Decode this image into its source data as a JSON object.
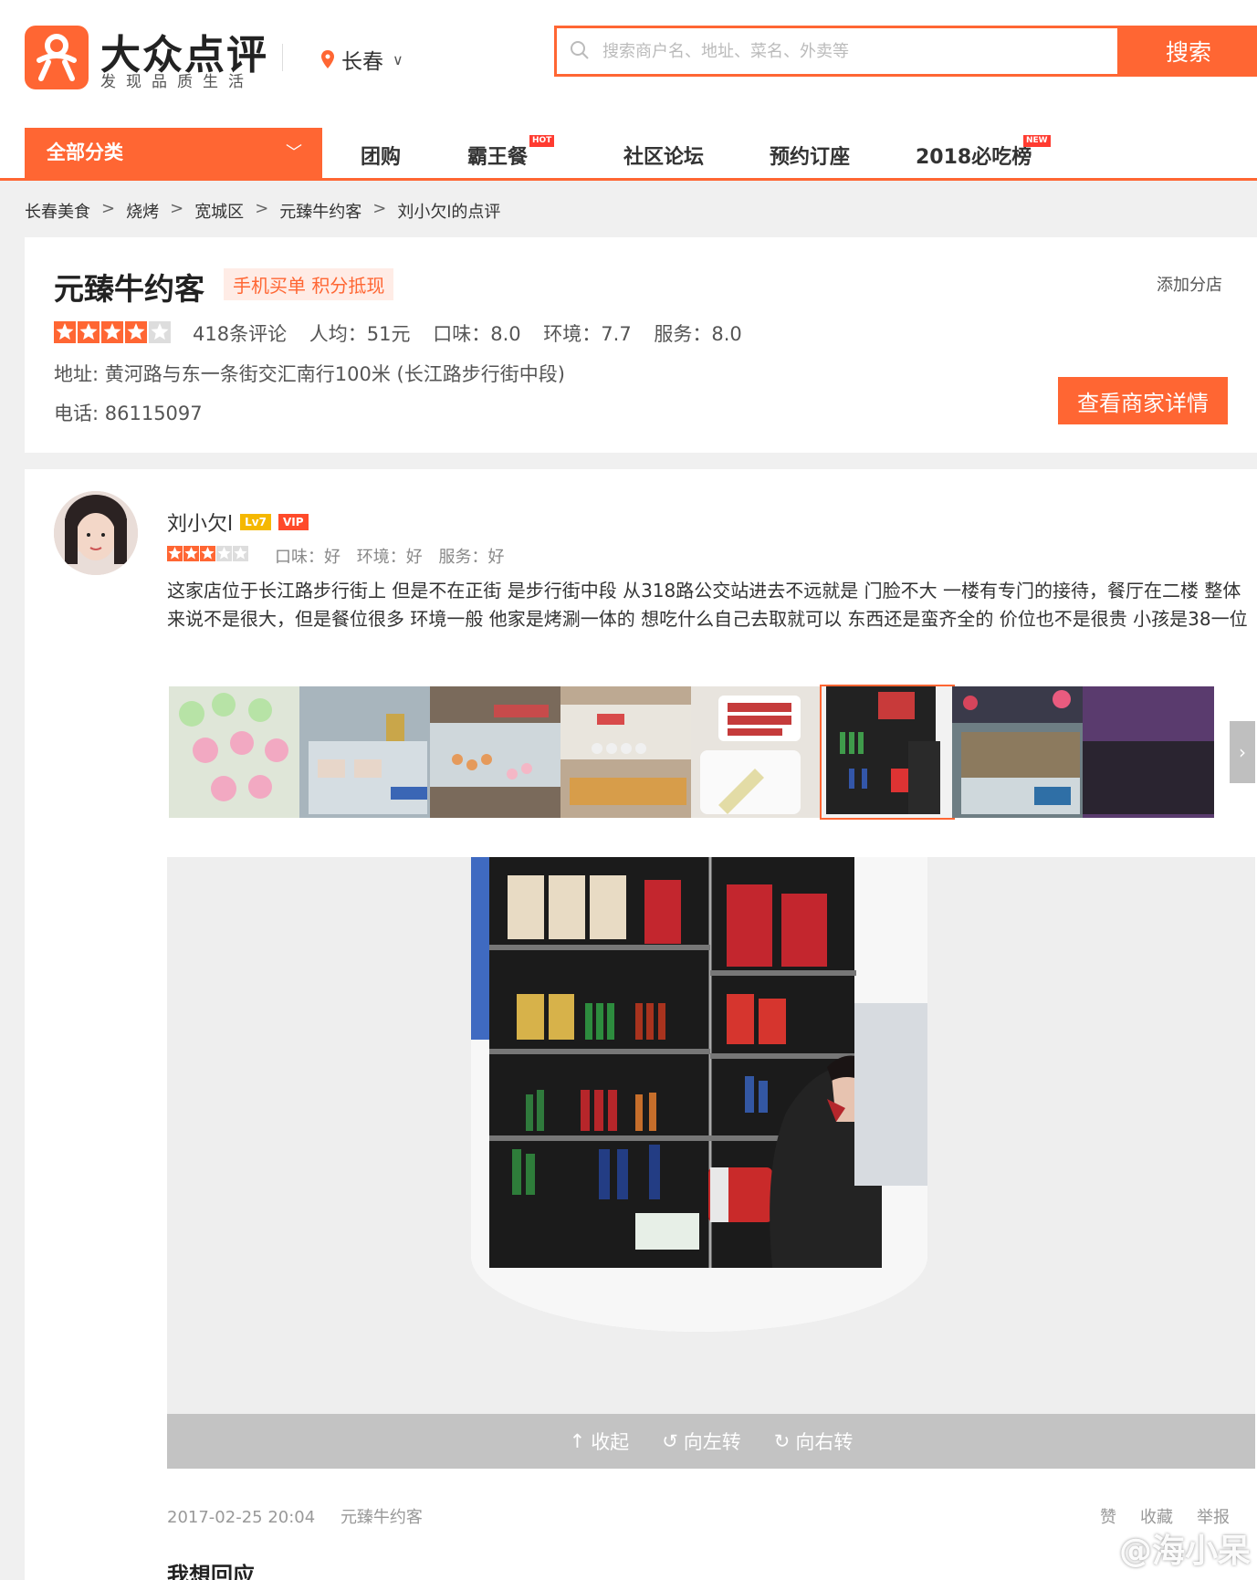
{
  "header": {
    "brand": "大众点评",
    "slogan": "发现品质生活",
    "city": "长春",
    "search_placeholder": "搜索商户名、地址、菜名、外卖等",
    "search_button": "搜索"
  },
  "nav": {
    "all_categories": "全部分类",
    "items": [
      {
        "label": "团购",
        "badge": ""
      },
      {
        "label": "霸王餐",
        "badge": "HOT"
      },
      {
        "label": "社区论坛",
        "badge": ""
      },
      {
        "label": "预约订座",
        "badge": ""
      },
      {
        "label": "2018必吃榜",
        "badge": "NEW"
      }
    ]
  },
  "breadcrumb": [
    "长春美食",
    "烧烤",
    "宽城区",
    "元臻牛约客",
    "刘小欠l的点评"
  ],
  "shop": {
    "name": "元臻牛约客",
    "promo": "手机买单 积分抵现",
    "add_branch": "添加分店",
    "star_rating": 4,
    "reviews": "418条评论",
    "avg_price": "人均：51元",
    "taste": "口味：8.0",
    "environment": "环境：7.7",
    "service": "服务：8.0",
    "address": "地址: 黄河路与东一条街交汇南行100米 (长江路步行街中段)",
    "phone": "电话: 86115097",
    "detail_button": "查看商家详情"
  },
  "review": {
    "username": "刘小欠l",
    "level": "Lv7",
    "vip": "VIP",
    "star_rating": 3,
    "taste": "口味：好",
    "environment": "环境：好",
    "service": "服务：好",
    "text": "这家店位于长江路步行街上 但是不在正街 是步行街中段 从318路公交站进去不远就是 门脸不大 一楼有专门的接待，餐厅在二楼 整体来说不是很大，但是餐位很多 环境一般 他家是烤涮一体的 想吃什么自己去取就可以 东西还是蛮齐全的 价位也不是很贵 小孩是38一位",
    "thumbnail_count": 8,
    "active_thumbnail": 6,
    "viewer_actions": [
      "收起",
      "向左转",
      "向右转"
    ],
    "date": "2017-02-25 20:04",
    "shop_link": "元臻牛约客",
    "actions": [
      "赞",
      "收藏",
      "举报"
    ],
    "reply_heading": "我想回应"
  },
  "watermark": "@海小呆",
  "colors": {
    "accent": "#ff6633",
    "hot_badge": "#ff3b30",
    "level_badge": "#f5b800"
  }
}
